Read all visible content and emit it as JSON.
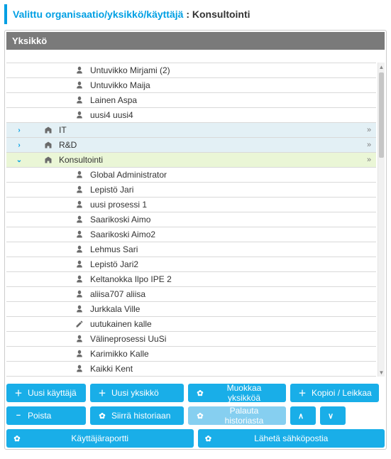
{
  "header": {
    "breadcrumb": "Valittu organisaatio/yksikkö/käyttäjä",
    "colon": " : ",
    "name": "Konsultointi"
  },
  "section_title": "Yksikkö",
  "tree": [
    {
      "type": "user",
      "indent": 3,
      "label": "Untuvikko Mirjami (2)"
    },
    {
      "type": "user",
      "indent": 3,
      "label": "Untuvikko Maija"
    },
    {
      "type": "user",
      "indent": 3,
      "label": "Lainen Aspa"
    },
    {
      "type": "user",
      "indent": 3,
      "label": "uusi4 uusi4"
    },
    {
      "type": "dept",
      "indent": 2,
      "label": "IT",
      "expanded": false,
      "more": true
    },
    {
      "type": "dept",
      "indent": 2,
      "label": "R&D",
      "expanded": false,
      "more": true
    },
    {
      "type": "dept",
      "indent": 2,
      "label": "Konsultointi",
      "expanded": true,
      "more": true
    },
    {
      "type": "user",
      "indent": 3,
      "label": "Global Administrator"
    },
    {
      "type": "user",
      "indent": 3,
      "label": "Lepistö Jari"
    },
    {
      "type": "user",
      "indent": 3,
      "label": "uusi prosessi 1"
    },
    {
      "type": "user",
      "indent": 3,
      "label": "Saarikoski Aimo"
    },
    {
      "type": "user",
      "indent": 3,
      "label": "Saarikoski Aimo2"
    },
    {
      "type": "user",
      "indent": 3,
      "label": "Lehmus Sari"
    },
    {
      "type": "user",
      "indent": 3,
      "label": "Lepistö Jari2"
    },
    {
      "type": "user",
      "indent": 3,
      "label": "Keltanokka Ilpo IPE 2"
    },
    {
      "type": "user",
      "indent": 3,
      "label": "aliisa707 aliisa"
    },
    {
      "type": "user",
      "indent": 3,
      "label": "Jurkkala Ville"
    },
    {
      "type": "edit",
      "indent": 3,
      "label": "uutukainen kalle"
    },
    {
      "type": "user",
      "indent": 3,
      "label": "Välineprosessi UuSi"
    },
    {
      "type": "user",
      "indent": 3,
      "label": "Karimikko Kalle"
    },
    {
      "type": "user",
      "indent": 3,
      "label": "Kaikki Kent"
    }
  ],
  "buttons": {
    "new_user": "Uusi käyttäjä",
    "new_unit": "Uusi yksikkö",
    "edit_unit": "Muokkaa yksikköä",
    "copy_cut": "Kopioi / Leikkaa",
    "delete": "Poista",
    "move_history": "Siirrä historiaan",
    "restore_history": "Palauta historiasta",
    "user_report": "Käyttäjäraportti",
    "send_email": "Lähetä sähköpostia"
  }
}
